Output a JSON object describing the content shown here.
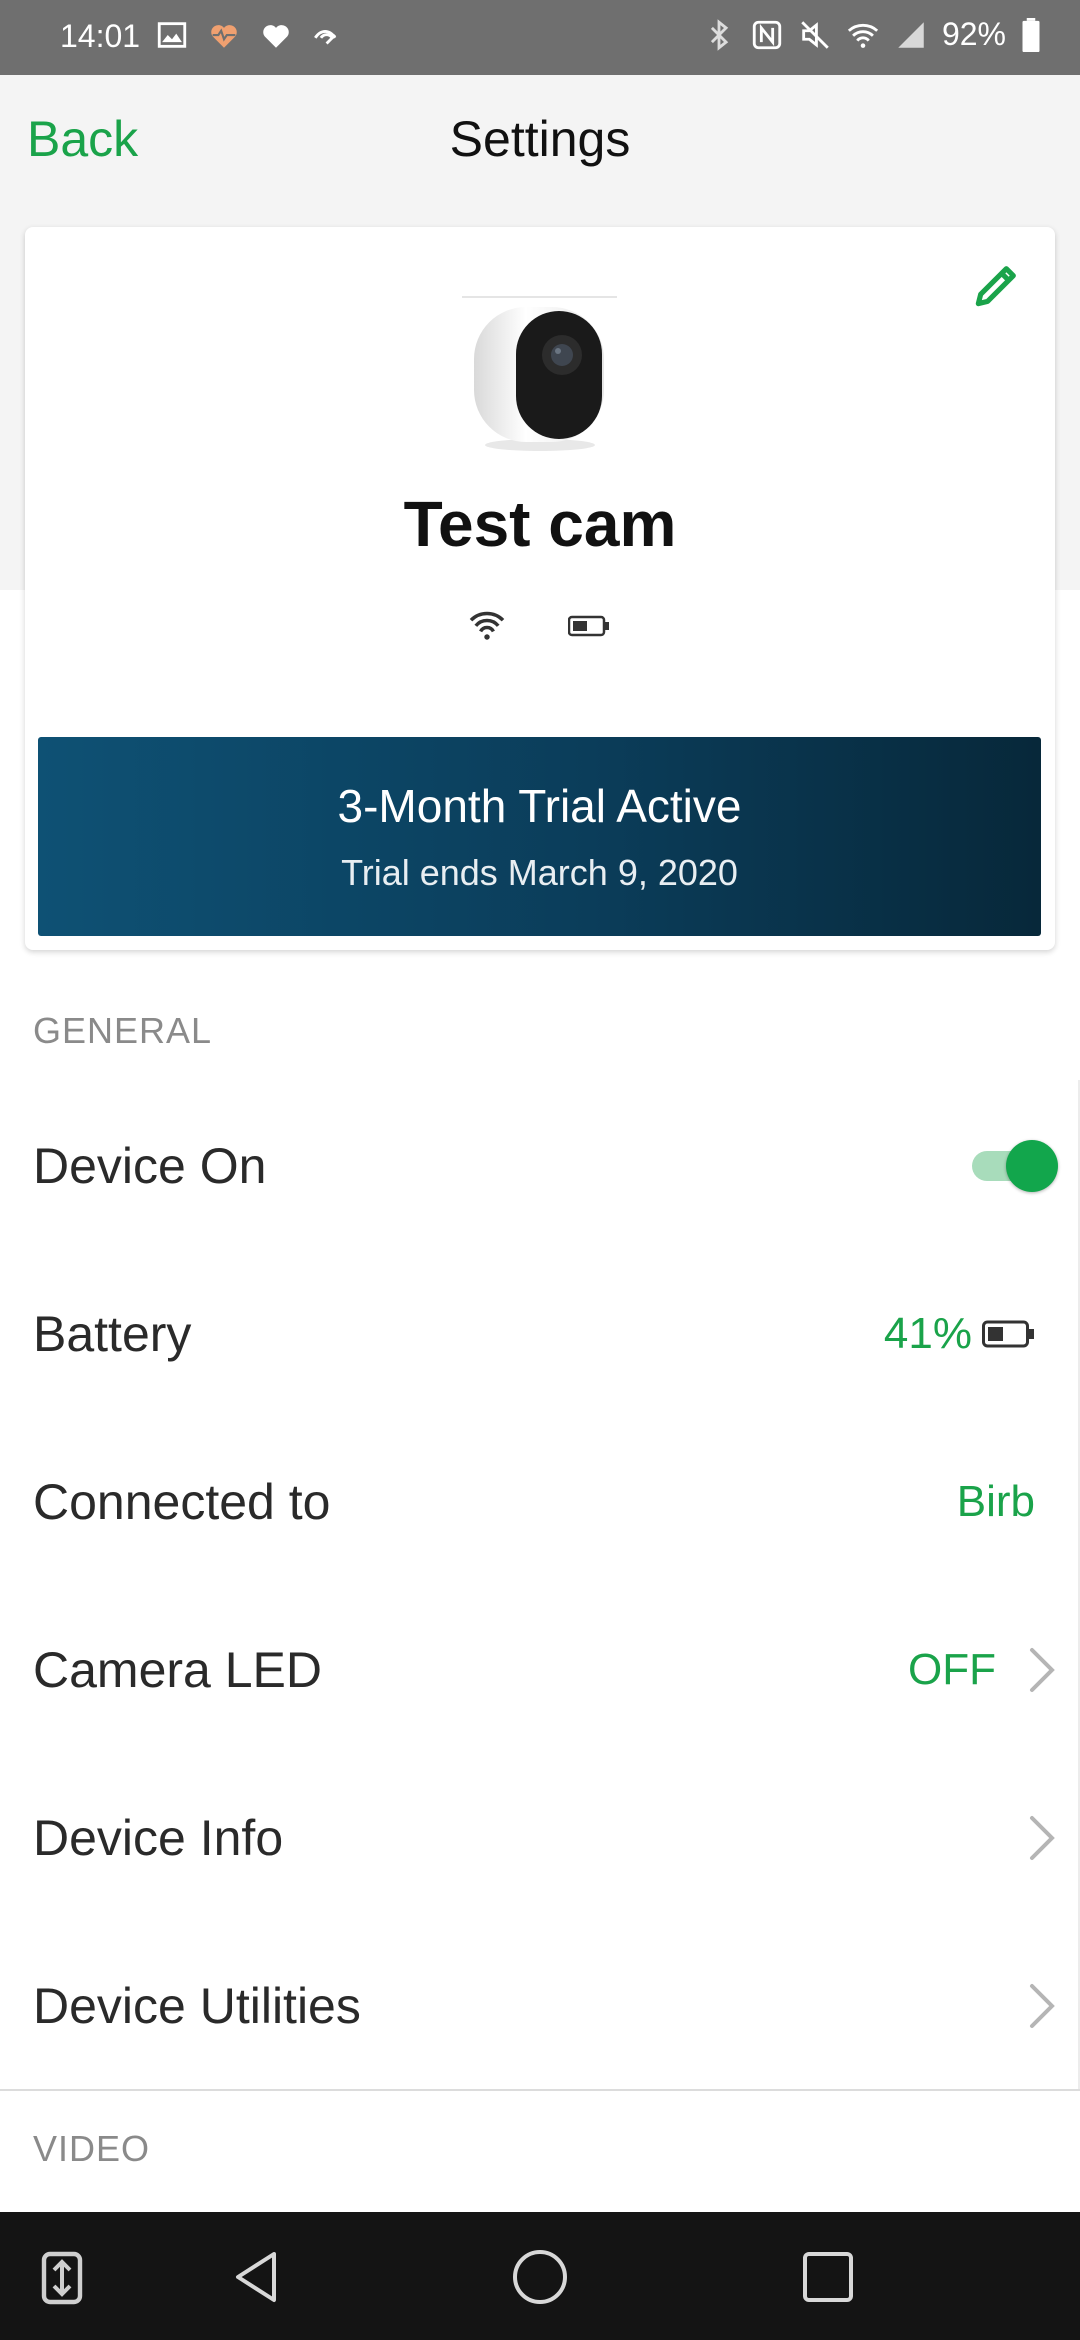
{
  "status_bar": {
    "time": "14:01",
    "battery_percent": "92%",
    "left_icons": [
      "gallery-icon",
      "health-icon",
      "heart-icon",
      "signal-swirl-icon"
    ],
    "right_icons": [
      "bluetooth-icon",
      "nfc-icon",
      "mute-icon",
      "wifi-icon",
      "cell-signal-icon",
      "battery-icon"
    ]
  },
  "header": {
    "back_label": "Back",
    "title": "Settings"
  },
  "device_card": {
    "name": "Test cam",
    "edit_icon": "pencil-icon",
    "status_icons": [
      "wifi-icon",
      "battery-icon"
    ],
    "trial": {
      "title": "3-Month Trial Active",
      "subtitle": "Trial ends March 9, 2020"
    }
  },
  "general": {
    "section_label": "GENERAL",
    "device_on": {
      "label": "Device On",
      "enabled": true
    },
    "battery": {
      "label": "Battery",
      "value": "41%",
      "level": 0.41
    },
    "connected_to": {
      "label": "Connected to",
      "value": "Birb"
    },
    "camera_led": {
      "label": "Camera LED",
      "value": "OFF"
    },
    "device_info": {
      "label": "Device Info"
    },
    "device_utilities": {
      "label": "Device Utilities"
    }
  },
  "video": {
    "section_label": "VIDEO"
  },
  "colors": {
    "accent_green": "#1aa34a",
    "trial_banner_start": "#0e5174",
    "trial_banner_end": "#07283a",
    "status_bar": "#6f6f6f",
    "nav_bar": "#141414"
  },
  "nav_bar": {
    "buttons": [
      "keyboard-switch-icon",
      "back-triangle-icon",
      "home-circle-icon",
      "recents-square-icon"
    ]
  }
}
